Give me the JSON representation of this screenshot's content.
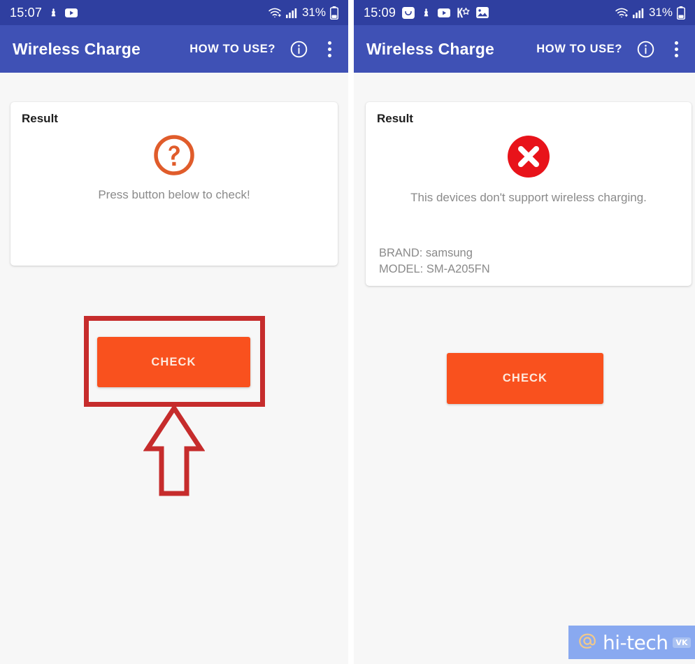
{
  "app": {
    "title": "Wireless Charge",
    "how_to_use_label": "HOW TO USE?",
    "info_icon": "info-circle-icon",
    "overflow_icon": "more-vertical-icon",
    "appbar_color": "#3f51b5",
    "statusbar_color": "#2f3fa0",
    "accent_orange": "#f9511e",
    "background_color": "#f7f7f7"
  },
  "screens": [
    {
      "id": "before-check",
      "statusbar": {
        "time": "15:07",
        "icons": [
          "download-icon",
          "youtube-icon"
        ],
        "wifi_icon": "wifi-icon",
        "signal_icon": "signal-bars-icon",
        "battery_percent": "31%",
        "battery_icon": "battery-icon"
      },
      "card": {
        "title": "Result",
        "state_icon": "question-circle-icon",
        "state_icon_color": "#e05c2b",
        "message": "Press button below to check!",
        "brand_line": "",
        "model_line": ""
      },
      "check_button_label": "CHECK",
      "annotation": {
        "box_color": "#c62c2c",
        "arrow_icon": "up-arrow-outline-icon"
      }
    },
    {
      "id": "after-check",
      "statusbar": {
        "time": "15:09",
        "icons": [
          "message-icon",
          "download-icon",
          "youtube-icon",
          "yandex-star-icon",
          "gallery-icon"
        ],
        "wifi_icon": "wifi-icon",
        "signal_icon": "signal-bars-icon",
        "battery_percent": "31%",
        "battery_icon": "battery-icon"
      },
      "card": {
        "title": "Result",
        "state_icon": "error-circle-icon",
        "state_icon_color": "#e8131a",
        "message": "This devices don't support wireless charging.",
        "brand_line": "BRAND: samsung",
        "model_line": "MODEL: SM-A205FN"
      },
      "check_button_label": "CHECK"
    }
  ],
  "watermark": {
    "at_icon": "at-sign-icon",
    "text": "hi-tech",
    "badge": "VK"
  }
}
